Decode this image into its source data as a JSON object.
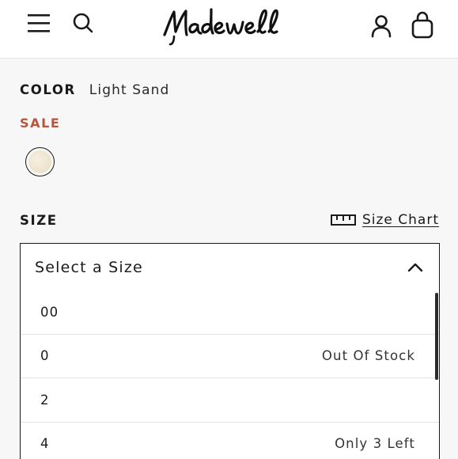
{
  "header": {
    "brand": "Madewell",
    "icons": [
      "hamburger-menu-icon",
      "search-icon",
      "account-icon",
      "shopping-bag-icon"
    ]
  },
  "product": {
    "color_label": "COLOR",
    "color_value": "Light Sand",
    "sale_label": "SALE",
    "swatch_color": "#ede4cf",
    "size_label": "SIZE",
    "size_chart_label": "Size Chart",
    "select_placeholder": "Select a Size",
    "size_options": [
      {
        "size": "00",
        "note": ""
      },
      {
        "size": "0",
        "note": "Out Of Stock"
      },
      {
        "size": "2",
        "note": ""
      },
      {
        "size": "4",
        "note": "Only 3 Left"
      }
    ]
  },
  "colors": {
    "sale": "#b8553c",
    "text": "#1a1a1a",
    "background": "#f7f7f7"
  }
}
